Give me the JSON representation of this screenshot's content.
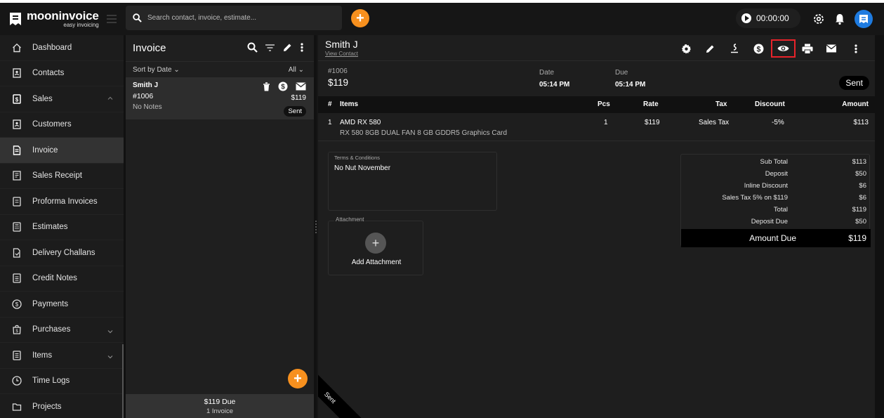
{
  "app": {
    "name": "mooninvoice",
    "tagline": "easy invoicing",
    "search_placeholder": "Search contact, invoice, estimate...",
    "timer": "00:00:00",
    "accent_color": "#f7901e",
    "highlight_color": "#e8232a"
  },
  "sidebar": {
    "items": [
      {
        "label": "Dashboard",
        "icon": "home-icon"
      },
      {
        "label": "Contacts",
        "icon": "contacts-icon"
      },
      {
        "label": "Sales",
        "icon": "dollar-doc-icon",
        "expanded": true
      },
      {
        "label": "Customers",
        "icon": "contacts-icon"
      },
      {
        "label": "Invoice",
        "icon": "invoice-icon",
        "active": true
      },
      {
        "label": "Sales Receipt",
        "icon": "receipt-icon"
      },
      {
        "label": "Proforma Invoices",
        "icon": "proforma-icon"
      },
      {
        "label": "Estimates",
        "icon": "calculator-icon"
      },
      {
        "label": "Delivery Challans",
        "icon": "delivery-icon"
      },
      {
        "label": "Credit Notes",
        "icon": "credit-note-icon"
      },
      {
        "label": "Payments",
        "icon": "dollar-circle-icon"
      },
      {
        "label": "Purchases",
        "icon": "bag-icon",
        "expandable": true
      },
      {
        "label": "Items",
        "icon": "list-icon",
        "expandable": true
      },
      {
        "label": "Time Logs",
        "icon": "clock-icon"
      },
      {
        "label": "Projects",
        "icon": "folder-icon"
      }
    ]
  },
  "list": {
    "title": "Invoice",
    "sort_label": "Sort by Date",
    "filter_label": "All",
    "card": {
      "name": "Smith J",
      "number": "#1006",
      "notes": "No Notes",
      "amount": "$119",
      "status": "Sent"
    },
    "footer": {
      "due": "$119  Due",
      "count": "1 Invoice"
    }
  },
  "detail": {
    "client": "Smith J",
    "view_contact": "View Contact",
    "invoice_number": "#1006",
    "total": "$119",
    "date_label": "Date",
    "date_value": "05:14 PM",
    "due_label": "Due",
    "due_value": "05:14 PM",
    "status": "Sent",
    "table": {
      "headers": {
        "num": "#",
        "items": "Items",
        "pcs": "Pcs",
        "rate": "Rate",
        "tax": "Tax",
        "discount": "Discount",
        "amount": "Amount"
      },
      "rows": [
        {
          "num": "1",
          "name": "AMD RX 580",
          "description": "RX 580 8GB DUAL FAN 8 GB GDDR5 Graphics Card",
          "pcs": "1",
          "rate": "$119",
          "tax": "Sales Tax",
          "discount": "-5%",
          "amount": "$113"
        }
      ]
    },
    "terms_label": "Terms & Conditions",
    "terms_value": "No Nut November",
    "attachment_label": "Attachment",
    "add_attachment": "Add Attachment",
    "totals": [
      {
        "label": "Sub Total",
        "value": "$113"
      },
      {
        "label": "Deposit",
        "value": "$50"
      },
      {
        "label": "Inline Discount",
        "value": "$6"
      },
      {
        "label": "Sales Tax 5% on $119",
        "value": "$6"
      },
      {
        "label": "Total",
        "value": "$119"
      },
      {
        "label": "Deposit Due",
        "value": "$50"
      }
    ],
    "amount_due_label": "Amount Due",
    "amount_due_value": "$119",
    "ribbon": "Sent"
  }
}
